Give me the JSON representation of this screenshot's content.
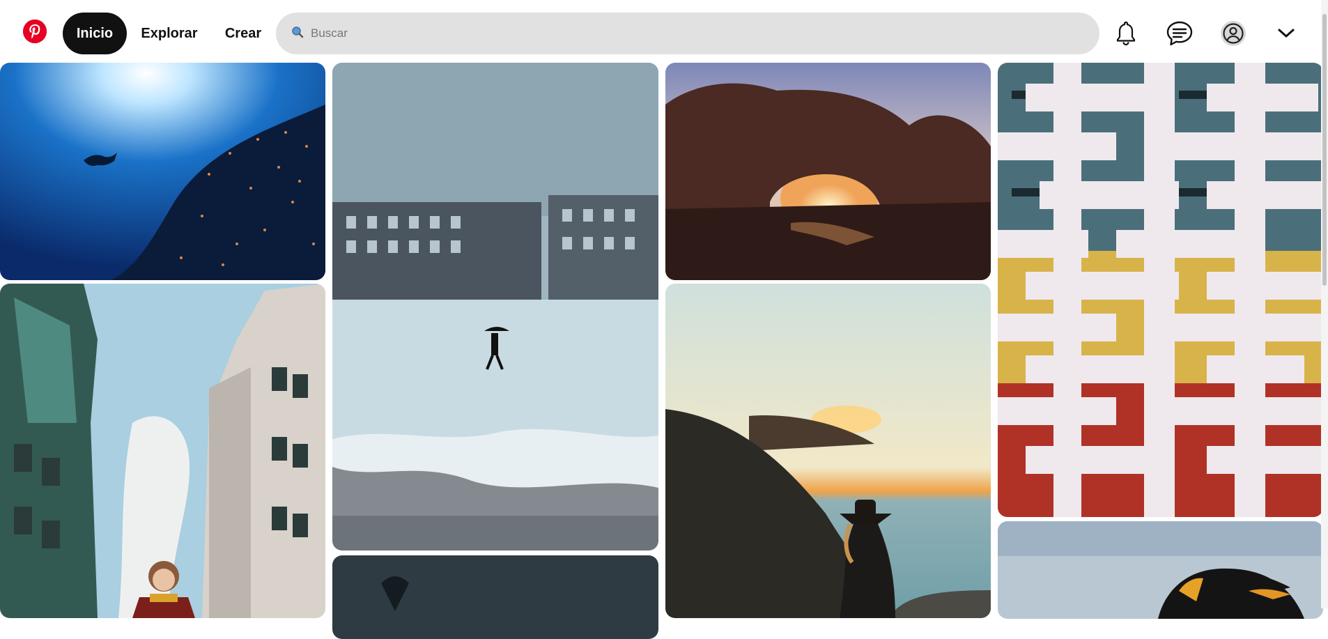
{
  "app": {
    "name": "Pinterest",
    "logo_icon": "pinterest-logo-icon",
    "brand_color": "#e60023"
  },
  "nav": {
    "home_label": "Inicio",
    "explore_label": "Explorar",
    "create_label": "Crear"
  },
  "search": {
    "placeholder": "Buscar",
    "value": "",
    "icon": "search-icon"
  },
  "header_icons": [
    "bell-icon",
    "chat-bubble-icon",
    "profile-avatar-icon",
    "chevron-down-icon"
  ],
  "pins": [
    {
      "id": "underwater-fish",
      "subject": "diver with school of fish"
    },
    {
      "id": "snow-umbrella",
      "subject": "person with umbrella walking in snow"
    },
    {
      "id": "rock-arch",
      "subject": "desert rock arch at sunset"
    },
    {
      "id": "building-facade",
      "subject": "white geometric building facade with balconies"
    },
    {
      "id": "wizard-street",
      "subject": "castle-like street with person in scarf"
    },
    {
      "id": "dark-pin",
      "subject": "dark partially visible pin"
    },
    {
      "id": "cliff-sunset",
      "subject": "woman in hat on cliff at sunset"
    },
    {
      "id": "penguin",
      "subject": "king penguin"
    }
  ],
  "colors": {
    "active_nav_bg": "#111111",
    "search_bg": "#e1e1e1",
    "text": "#111111"
  }
}
